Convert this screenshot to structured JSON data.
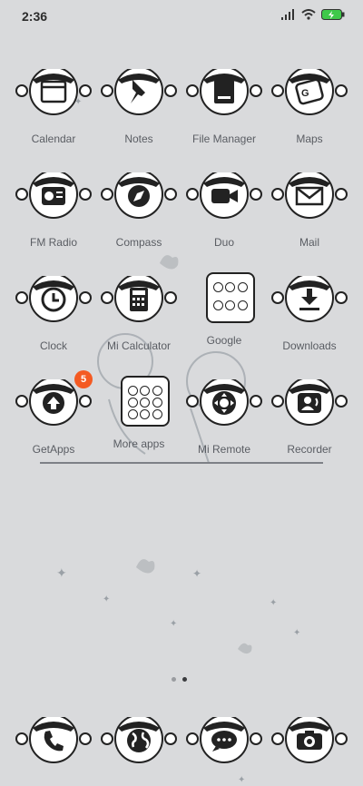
{
  "status_bar": {
    "time": "2:36"
  },
  "apps": [
    {
      "label": "Calendar",
      "icon": "calendar-icon"
    },
    {
      "label": "Notes",
      "icon": "pin-icon"
    },
    {
      "label": "File Manager",
      "icon": "folder-icon"
    },
    {
      "label": "Maps",
      "icon": "map-icon"
    },
    {
      "label": "FM Radio",
      "icon": "radio-icon"
    },
    {
      "label": "Compass",
      "icon": "compass-icon"
    },
    {
      "label": "Duo",
      "icon": "video-camera-icon"
    },
    {
      "label": "Mail",
      "icon": "envelope-icon"
    },
    {
      "label": "Clock",
      "icon": "clock-icon"
    },
    {
      "label": "Mi Calculator",
      "icon": "calculator-icon"
    },
    {
      "label": "Google",
      "icon": "folder-grid-icon"
    },
    {
      "label": "Downloads",
      "icon": "download-icon"
    },
    {
      "label": "GetApps",
      "icon": "upload-icon",
      "badge": "5"
    },
    {
      "label": "More apps",
      "icon": "folder-grid-icon"
    },
    {
      "label": "Mi Remote",
      "icon": "remote-icon"
    },
    {
      "label": "Recorder",
      "icon": "microphone-person-icon"
    }
  ],
  "dock": [
    {
      "icon": "phone-icon"
    },
    {
      "icon": "globe-icon"
    },
    {
      "icon": "chat-icon"
    },
    {
      "icon": "camera-icon"
    }
  ],
  "page_indicator": {
    "pages": 2,
    "current": 2
  },
  "colors": {
    "badge": "#f45a22",
    "background": "#d9dadc"
  }
}
